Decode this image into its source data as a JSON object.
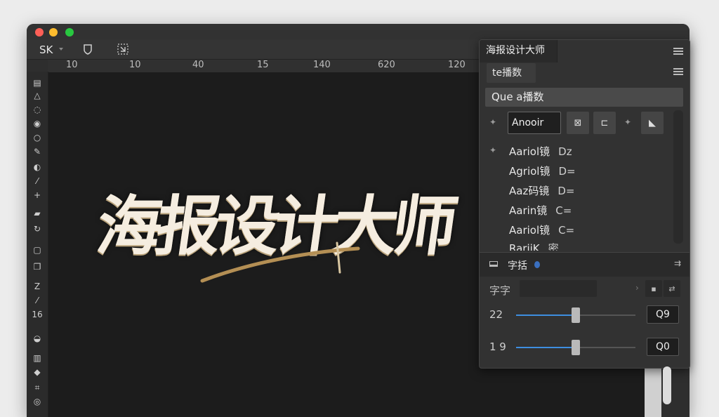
{
  "toolbar": {
    "app_label": "SK"
  },
  "ruler": {
    "labels": [
      "10",
      "10",
      "40",
      "15",
      "140",
      "620",
      "120"
    ]
  },
  "tools": [
    "16"
  ],
  "canvas": {
    "poster_title": "海报设计大师"
  },
  "panel": {
    "title": "海报设计大师",
    "sub_tab": "te播数",
    "search_value": "Que a播数",
    "font_input_value": "Anooir",
    "fonts": [
      {
        "name": "Aariol镜",
        "meta": "Dz"
      },
      {
        "name": "Agriol镜",
        "meta": "D="
      },
      {
        "name": "Aaz码镜",
        "meta": "D="
      },
      {
        "name": "Aarin镜",
        "meta": "C="
      },
      {
        "name": "Aariol镜",
        "meta": "C="
      },
      {
        "name": "RariiK",
        "meta": "密"
      }
    ],
    "section": {
      "title": "字括"
    },
    "prop_label": "字字",
    "sliders": [
      {
        "value": "22",
        "box": "Q9",
        "fill_fraction": 0.5
      },
      {
        "value": "1 9",
        "box": "Q0",
        "fill_fraction": 0.5
      }
    ]
  }
}
